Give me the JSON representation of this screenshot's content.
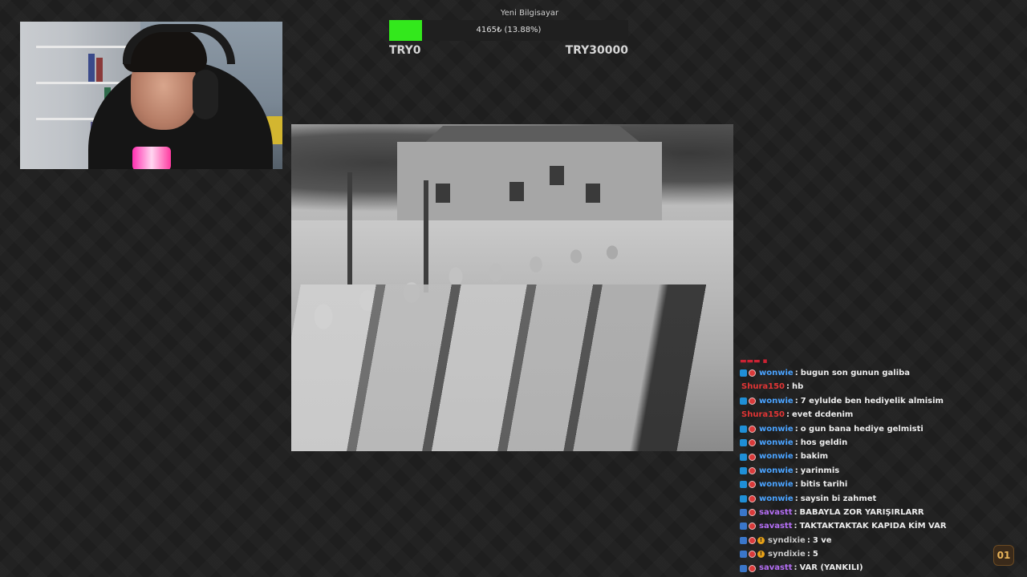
{
  "goal": {
    "title": "Yeni Bilgisayar",
    "amount_text": "4165₺ (13.88%)",
    "progress_fraction": 0.1388,
    "min_label": "TRY0",
    "max_label": "TRY30000"
  },
  "chat": {
    "messages": [
      {
        "user": "wonwie",
        "color": "blue",
        "badges": [
          "mod",
          "sub"
        ],
        "text": "bugun son gunun galiba"
      },
      {
        "user": "Shura150",
        "color": "red",
        "badges": [],
        "text": "hb"
      },
      {
        "user": "wonwie",
        "color": "blue",
        "badges": [
          "mod",
          "sub"
        ],
        "text": "7 eylulde ben hediyelik almisim"
      },
      {
        "user": "Shura150",
        "color": "red",
        "badges": [],
        "text": "evet dcdenim"
      },
      {
        "user": "wonwie",
        "color": "blue",
        "badges": [
          "mod",
          "sub"
        ],
        "text": "o gun bana hediye gelmisti"
      },
      {
        "user": "wonwie",
        "color": "blue",
        "badges": [
          "mod",
          "sub"
        ],
        "text": "hos geldin"
      },
      {
        "user": "wonwie",
        "color": "blue",
        "badges": [
          "mod",
          "sub"
        ],
        "text": "bakim"
      },
      {
        "user": "wonwie",
        "color": "blue",
        "badges": [
          "mod",
          "sub"
        ],
        "text": "yarinmis"
      },
      {
        "user": "wonwie",
        "color": "blue",
        "badges": [
          "mod",
          "sub"
        ],
        "text": "bitis tarihi"
      },
      {
        "user": "wonwie",
        "color": "blue",
        "badges": [
          "mod",
          "sub"
        ],
        "text": "saysin bi zahmet"
      },
      {
        "user": "savastt",
        "color": "purple",
        "badges": [
          "vip",
          "sub"
        ],
        "text": "BABAYLA ZOR YARIŞIRLARR"
      },
      {
        "user": "savastt",
        "color": "purple",
        "badges": [
          "vip",
          "sub"
        ],
        "text": "TAKTAKTAKTAK KAPIDA KİM VAR"
      },
      {
        "user": "syndixie",
        "color": "gray",
        "badges": [
          "vip",
          "sub",
          "gold"
        ],
        "text": "3 ve"
      },
      {
        "user": "syndixie",
        "color": "gray",
        "badges": [
          "vip",
          "sub",
          "gold"
        ],
        "text": "5"
      },
      {
        "user": "savastt",
        "color": "purple",
        "badges": [
          "vip",
          "sub"
        ],
        "text": "VAR (YANKILI)"
      }
    ]
  },
  "channel_logo": {
    "text": "01"
  }
}
